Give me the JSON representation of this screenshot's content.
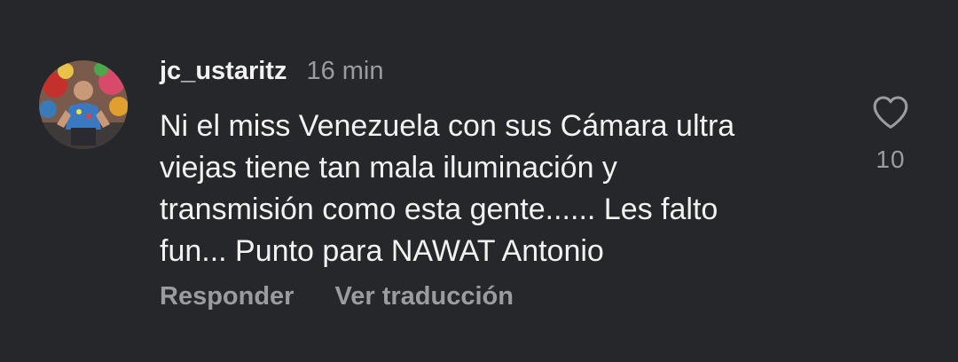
{
  "comment": {
    "username": "jc_ustaritz",
    "timestamp": "16 min",
    "text_lines": [
      "Ni el miss Venezuela con sus Cámara ultra",
      "viejas tiene tan mala iluminación y",
      "transmisión como esta gente...... Les falto",
      "fun... Punto para NAWAT Antonio"
    ],
    "actions": {
      "reply_label": "Responder",
      "translate_label": "Ver traducción"
    },
    "like_count": "10",
    "avatar_icon": "user-avatar-photo",
    "like_icon": "heart-outline-icon"
  },
  "colors": {
    "background": "#26272b",
    "primary_text": "#f2f2f2",
    "secondary_text": "#9b9ca2"
  }
}
